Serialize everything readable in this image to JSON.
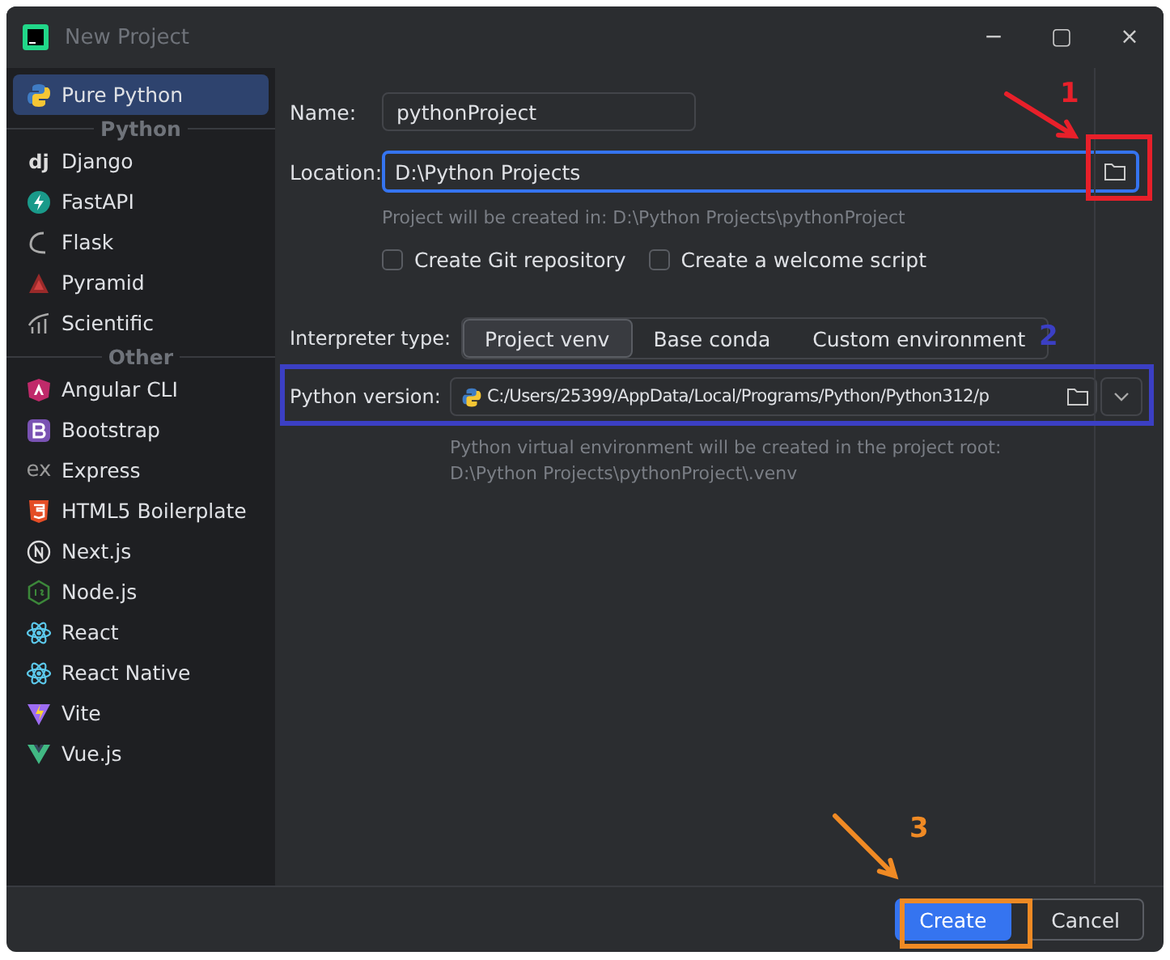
{
  "window": {
    "title": "New Project",
    "controls": [
      "−",
      "▢",
      "×"
    ]
  },
  "sidebar": {
    "groups": [
      {
        "items": [
          {
            "label": "Pure Python",
            "selected": true
          }
        ]
      },
      {
        "header": "Python",
        "items": [
          {
            "label": "Django",
            "selected": false,
            "icon_text": "dj"
          },
          {
            "label": "FastAPI",
            "selected": false
          },
          {
            "label": "Flask",
            "selected": false
          },
          {
            "label": "Pyramid",
            "selected": false
          },
          {
            "label": "Scientific",
            "selected": false
          }
        ]
      },
      {
        "header": "Other",
        "items": [
          {
            "label": "Angular CLI",
            "selected": false
          },
          {
            "label": "Bootstrap",
            "selected": false
          },
          {
            "label": "Express",
            "selected": false,
            "icon_text": "ex"
          },
          {
            "label": "HTML5 Boilerplate",
            "selected": false
          },
          {
            "label": "Next.js",
            "selected": false
          },
          {
            "label": "Node.js",
            "selected": false
          },
          {
            "label": "React",
            "selected": false
          },
          {
            "label": "React Native",
            "selected": false
          },
          {
            "label": "Vite",
            "selected": false
          },
          {
            "label": "Vue.js",
            "selected": false
          }
        ]
      }
    ]
  },
  "form": {
    "name": {
      "label": "Name:",
      "value": "pythonProject"
    },
    "location": {
      "label": "Location:",
      "value": "D:\\Python Projects",
      "hint": "Project will be created in: D:\\Python Projects\\pythonProject"
    },
    "checkboxes": [
      {
        "label": "Create Git repository",
        "checked": false
      },
      {
        "label": "Create a welcome script",
        "checked": false
      }
    ],
    "interpreter_type": {
      "label": "Interpreter type:",
      "options": [
        {
          "label": "Project venv",
          "selected": true
        },
        {
          "label": "Base conda",
          "selected": false
        },
        {
          "label": "Custom environment",
          "selected": false
        }
      ]
    },
    "python_version": {
      "label": "Python version:",
      "value": "C:/Users/25399/AppData/Local/Programs/Python/Python312/p",
      "hint": "Python virtual environment will be created in the project root: D:\\Python Projects\\pythonProject\\.venv"
    }
  },
  "buttons": [
    {
      "label": "Create",
      "kind": "primary"
    },
    {
      "label": "Cancel",
      "kind": "secondary"
    }
  ],
  "annotations": [
    {
      "label": "1",
      "color": "#e8202a"
    },
    {
      "label": "2",
      "color": "#3b3fc4"
    },
    {
      "label": "3",
      "color": "#f08a24"
    }
  ]
}
